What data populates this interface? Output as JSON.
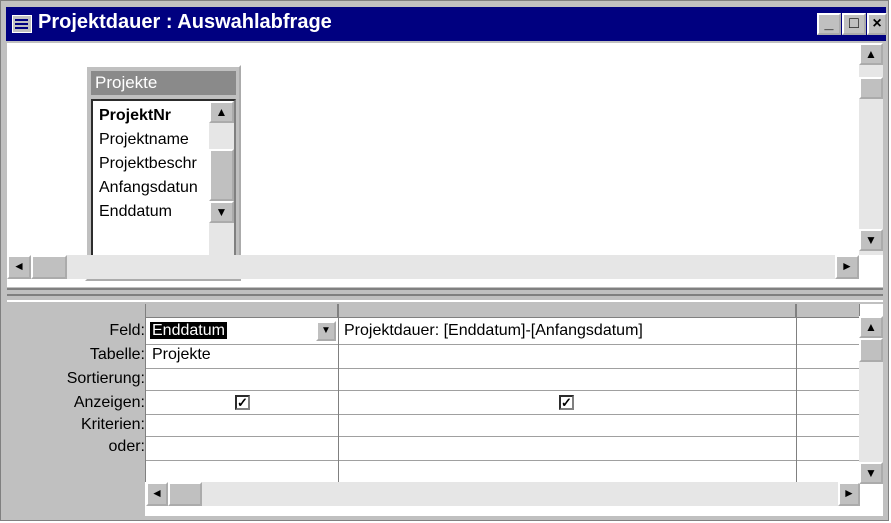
{
  "window": {
    "title": "Projektdauer : Auswahlabfrage",
    "buttons": {
      "minimize": "_",
      "maximize": "□",
      "close": "×"
    }
  },
  "table_box": {
    "title": "Projekte",
    "fields": [
      "ProjektNr",
      "Projektname",
      "Projektbeschr",
      "Anfangsdatun",
      "Enddatum"
    ]
  },
  "grid": {
    "row_labels": [
      "Feld:",
      "Tabelle:",
      "Sortierung:",
      "Anzeigen:",
      "Kriterien:",
      "oder:"
    ],
    "columns": [
      {
        "field": "Enddatum",
        "table": "Projekte",
        "sort": "",
        "show": true,
        "criteria": "",
        "or": ""
      },
      {
        "field": "Projektdauer: [Enddatum]-[Anfangsdatum]",
        "table": "",
        "sort": "",
        "show": true,
        "criteria": "",
        "or": ""
      }
    ]
  },
  "icons": {
    "up": "▲",
    "down": "▼",
    "left": "◄",
    "right": "►",
    "dropdown": "▼",
    "check": "✓"
  },
  "colors": {
    "titlebar": "#000080",
    "face": "#c0c0c0",
    "table_title": "#8a8a8a"
  }
}
